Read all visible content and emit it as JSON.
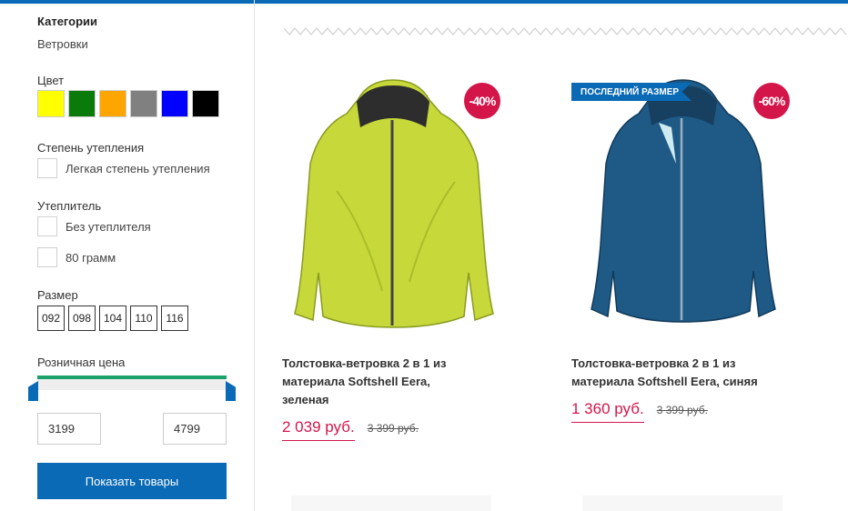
{
  "filters": {
    "category_title": "Категории",
    "category_item": "Ветровки",
    "color_title": "Цвет",
    "colors": [
      "#ffff00",
      "#0a7a0a",
      "#ffa500",
      "#808080",
      "#0000ff",
      "#000000"
    ],
    "insulation_degree_title": "Степень утепления",
    "insulation_degree_options": [
      "Легкая степень утепления"
    ],
    "insulation_title": "Утеплитель",
    "insulation_options": [
      "Без утеплителя",
      "80 грамм"
    ],
    "size_title": "Размер",
    "sizes": [
      "092",
      "098",
      "104",
      "110",
      "116"
    ],
    "price_title": "Розничная цена",
    "price_min": "3199",
    "price_max": "4799",
    "show_button": "Показать товары"
  },
  "products": [
    {
      "discount": "-40%",
      "badge": "",
      "title": "Толстовка-ветровка 2 в 1 из материала Softshell Eera, зеленая",
      "price": "2 039 руб.",
      "old_price": "3 399 руб.",
      "color": "#c8dc3c"
    },
    {
      "discount": "-60%",
      "badge": "ПОСЛЕДНИЙ РАЗМЕР",
      "title": "Толстовка-ветровка 2 в 1 из материала Softshell Eera, синяя",
      "price": "1 360 руб.",
      "old_price": "3 399 руб.",
      "color": "#1f5a86"
    }
  ]
}
